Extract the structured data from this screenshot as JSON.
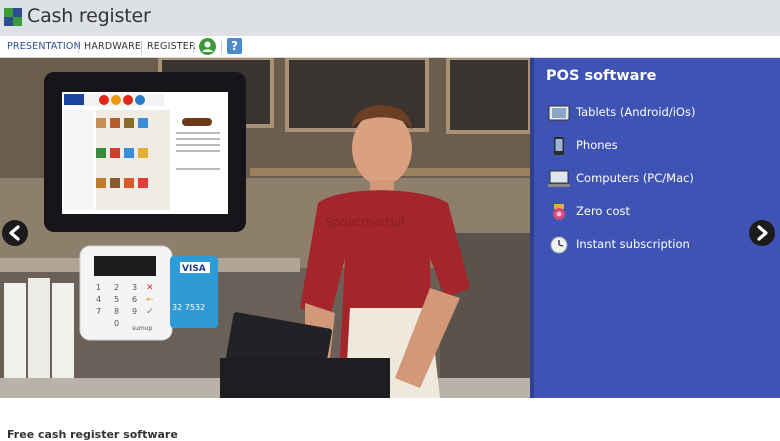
{
  "header": {
    "title": "Cash register",
    "logo_icon": "logo-squares-icon",
    "logo_colors": [
      "#3a9b3a",
      "#2c4d8e",
      "#2c4d8e",
      "#3a9b3a"
    ]
  },
  "nav": {
    "items": [
      {
        "label": "PRESENTATION",
        "active": true
      },
      {
        "label": "HARDWARE",
        "active": false
      },
      {
        "label": "REGISTER",
        "active": false
      }
    ],
    "user_icon": "user-account-icon",
    "help_label": "?"
  },
  "hero": {
    "panel": {
      "title": "POS software",
      "features": [
        {
          "label": "Tablets (Android/iOs)",
          "icon": "tablet-icon"
        },
        {
          "label": "Phones",
          "icon": "phone-icon"
        },
        {
          "label": "Computers (PC/Mac)",
          "icon": "computer-icon"
        },
        {
          "label": "Zero cost",
          "icon": "piggy-bank-icon"
        },
        {
          "label": "Instant subscription",
          "icon": "clock-icon"
        }
      ],
      "background": "#3e53b4"
    },
    "card_brand": "VISA",
    "card_number": "32 7532",
    "terminal_brand": "sumup",
    "prev_icon": "chevron-left-icon",
    "next_icon": "chevron-right-icon",
    "watermark": "Spdacmartial"
  },
  "main": {
    "headline": "Free cash register software"
  }
}
